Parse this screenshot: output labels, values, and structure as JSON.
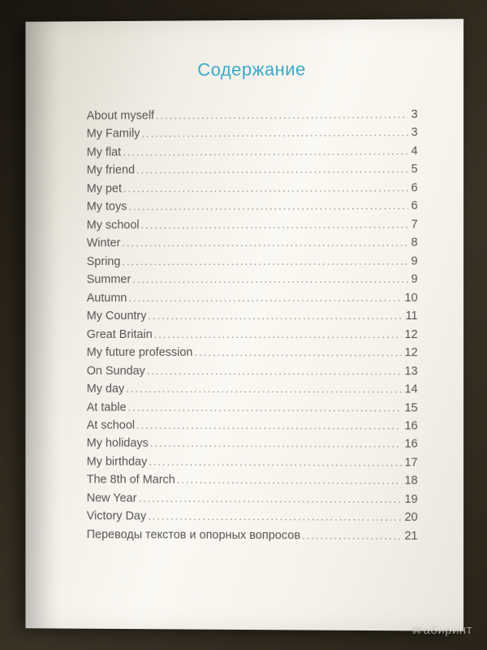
{
  "title": "Содержание",
  "entries": [
    {
      "label": "About myself",
      "page": "3"
    },
    {
      "label": "My Family",
      "page": "3"
    },
    {
      "label": "My flat",
      "page": "4"
    },
    {
      "label": "My friend",
      "page": "5"
    },
    {
      "label": "My pet",
      "page": "6"
    },
    {
      "label": "My toys",
      "page": "6"
    },
    {
      "label": "My school",
      "page": "7"
    },
    {
      "label": "Winter",
      "page": "8"
    },
    {
      "label": "Spring",
      "page": "9"
    },
    {
      "label": "Summer",
      "page": "9"
    },
    {
      "label": "Autumn",
      "page": "10"
    },
    {
      "label": "My Country",
      "page": "11"
    },
    {
      "label": "Great Britain",
      "page": "12"
    },
    {
      "label": "My future profession",
      "page": "12"
    },
    {
      "label": "On Sunday",
      "page": "13"
    },
    {
      "label": "My day",
      "page": "14"
    },
    {
      "label": "At table",
      "page": "15"
    },
    {
      "label": "At school",
      "page": "16"
    },
    {
      "label": "My holidays",
      "page": "16"
    },
    {
      "label": "My birthday",
      "page": "17"
    },
    {
      "label": "The 8th of March",
      "page": "18"
    },
    {
      "label": "New Year",
      "page": "19"
    },
    {
      "label": "Victory Day",
      "page": "20"
    },
    {
      "label": "Переводы текстов и опорных вопросов",
      "page": "21"
    }
  ],
  "watermark": "абиринт"
}
